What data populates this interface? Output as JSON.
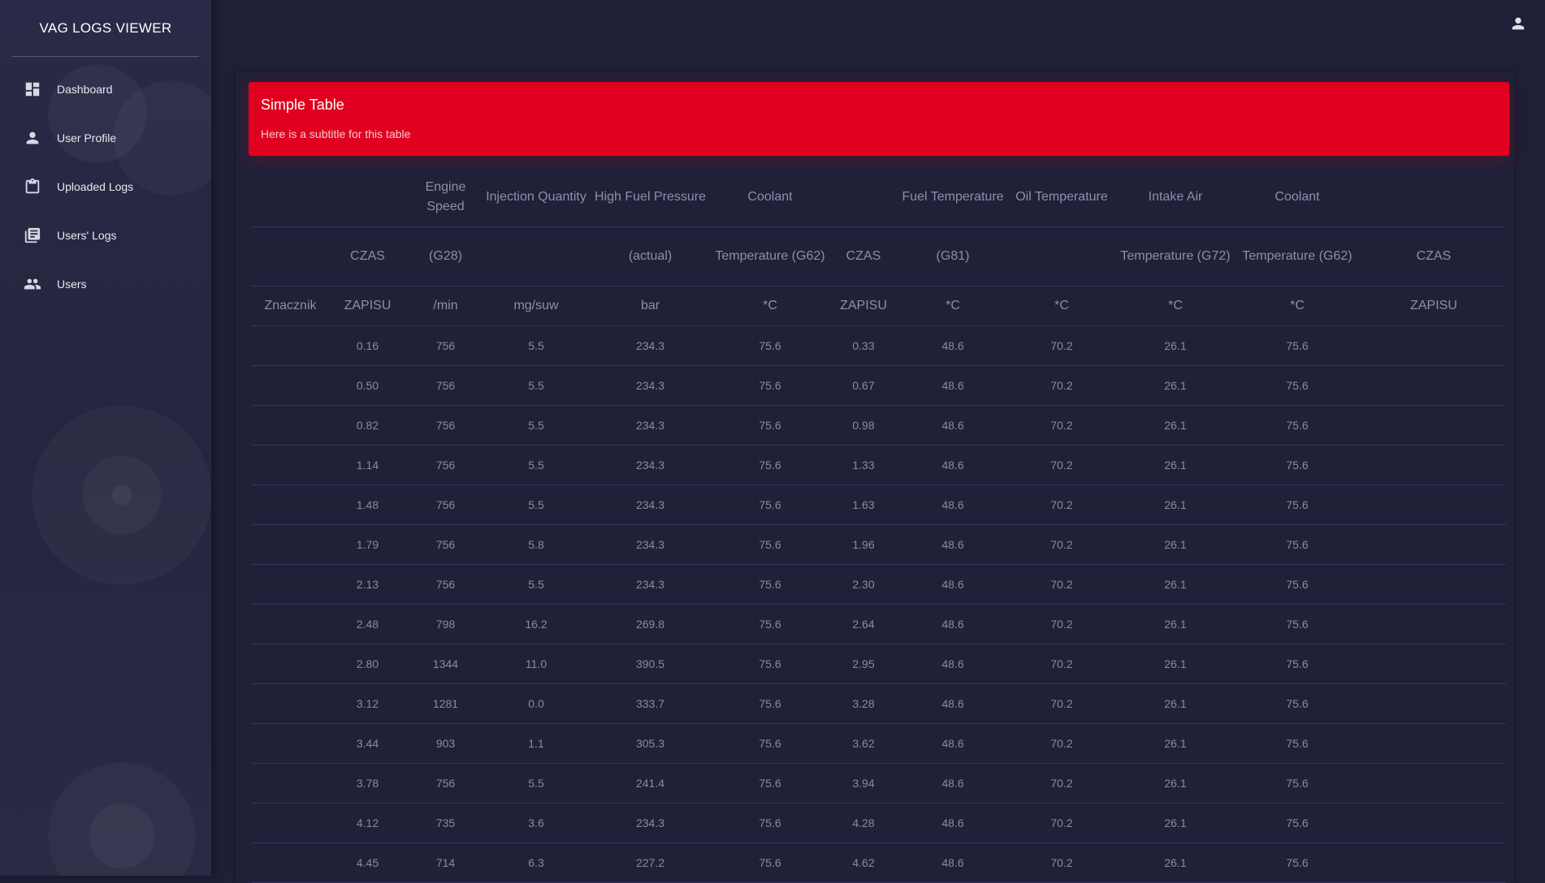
{
  "app": {
    "title": "VAG LOGS VIEWER"
  },
  "sidebar": {
    "items": [
      {
        "label": "Dashboard",
        "icon": "dashboard-icon"
      },
      {
        "label": "User Profile",
        "icon": "person-icon"
      },
      {
        "label": "Uploaded Logs",
        "icon": "clipboard-icon"
      },
      {
        "label": "Users' Logs",
        "icon": "library-books-icon"
      },
      {
        "label": "Users",
        "icon": "people-icon"
      }
    ]
  },
  "topbar": {
    "user_icon": "account-icon"
  },
  "card": {
    "title": "Simple Table",
    "subtitle": "Here is a subtitle for this table",
    "accent_color": "#e1001f"
  },
  "table": {
    "header_row1": [
      "",
      "",
      "Engine Speed",
      "Injection Quantity",
      "High Fuel Pressure",
      "Coolant",
      "",
      "Fuel Temperature",
      "Oil Temperature",
      "Intake Air",
      "Coolant",
      ""
    ],
    "header_row2": [
      "",
      "CZAS",
      "(G28)",
      "",
      "(actual)",
      "Temperature (G62)",
      "CZAS",
      "(G81)",
      "",
      "Temperature (G72)",
      "Temperature (G62)",
      "CZAS"
    ],
    "header_row3": [
      "Znacznik",
      "ZAPISU",
      "/min",
      "mg/suw",
      "bar",
      "*C",
      "ZAPISU",
      "*C",
      "*C",
      "*C",
      "*C",
      "ZAPISU"
    ],
    "rows": [
      [
        "",
        "0.16",
        "756",
        "5.5",
        "234.3",
        "75.6",
        "0.33",
        "48.6",
        "70.2",
        "26.1",
        "75.6",
        ""
      ],
      [
        "",
        "0.50",
        "756",
        "5.5",
        "234.3",
        "75.6",
        "0.67",
        "48.6",
        "70.2",
        "26.1",
        "75.6",
        ""
      ],
      [
        "",
        "0.82",
        "756",
        "5.5",
        "234.3",
        "75.6",
        "0.98",
        "48.6",
        "70.2",
        "26.1",
        "75.6",
        ""
      ],
      [
        "",
        "1.14",
        "756",
        "5.5",
        "234.3",
        "75.6",
        "1.33",
        "48.6",
        "70.2",
        "26.1",
        "75.6",
        ""
      ],
      [
        "",
        "1.48",
        "756",
        "5.5",
        "234.3",
        "75.6",
        "1.63",
        "48.6",
        "70.2",
        "26.1",
        "75.6",
        ""
      ],
      [
        "",
        "1.79",
        "756",
        "5.8",
        "234.3",
        "75.6",
        "1.96",
        "48.6",
        "70.2",
        "26.1",
        "75.6",
        ""
      ],
      [
        "",
        "2.13",
        "756",
        "5.5",
        "234.3",
        "75.6",
        "2.30",
        "48.6",
        "70.2",
        "26.1",
        "75.6",
        ""
      ],
      [
        "",
        "2.48",
        "798",
        "16.2",
        "269.8",
        "75.6",
        "2.64",
        "48.6",
        "70.2",
        "26.1",
        "75.6",
        ""
      ],
      [
        "",
        "2.80",
        "1344",
        "11.0",
        "390.5",
        "75.6",
        "2.95",
        "48.6",
        "70.2",
        "26.1",
        "75.6",
        ""
      ],
      [
        "",
        "3.12",
        "1281",
        "0.0",
        "333.7",
        "75.6",
        "3.28",
        "48.6",
        "70.2",
        "26.1",
        "75.6",
        ""
      ],
      [
        "",
        "3.44",
        "903",
        "1.1",
        "305.3",
        "75.6",
        "3.62",
        "48.6",
        "70.2",
        "26.1",
        "75.6",
        ""
      ],
      [
        "",
        "3.78",
        "756",
        "5.5",
        "241.4",
        "75.6",
        "3.94",
        "48.6",
        "70.2",
        "26.1",
        "75.6",
        ""
      ],
      [
        "",
        "4.12",
        "735",
        "3.6",
        "234.3",
        "75.6",
        "4.28",
        "48.6",
        "70.2",
        "26.1",
        "75.6",
        ""
      ],
      [
        "",
        "4.45",
        "714",
        "6.3",
        "227.2",
        "75.6",
        "4.62",
        "48.6",
        "70.2",
        "26.1",
        "75.6",
        ""
      ]
    ]
  }
}
